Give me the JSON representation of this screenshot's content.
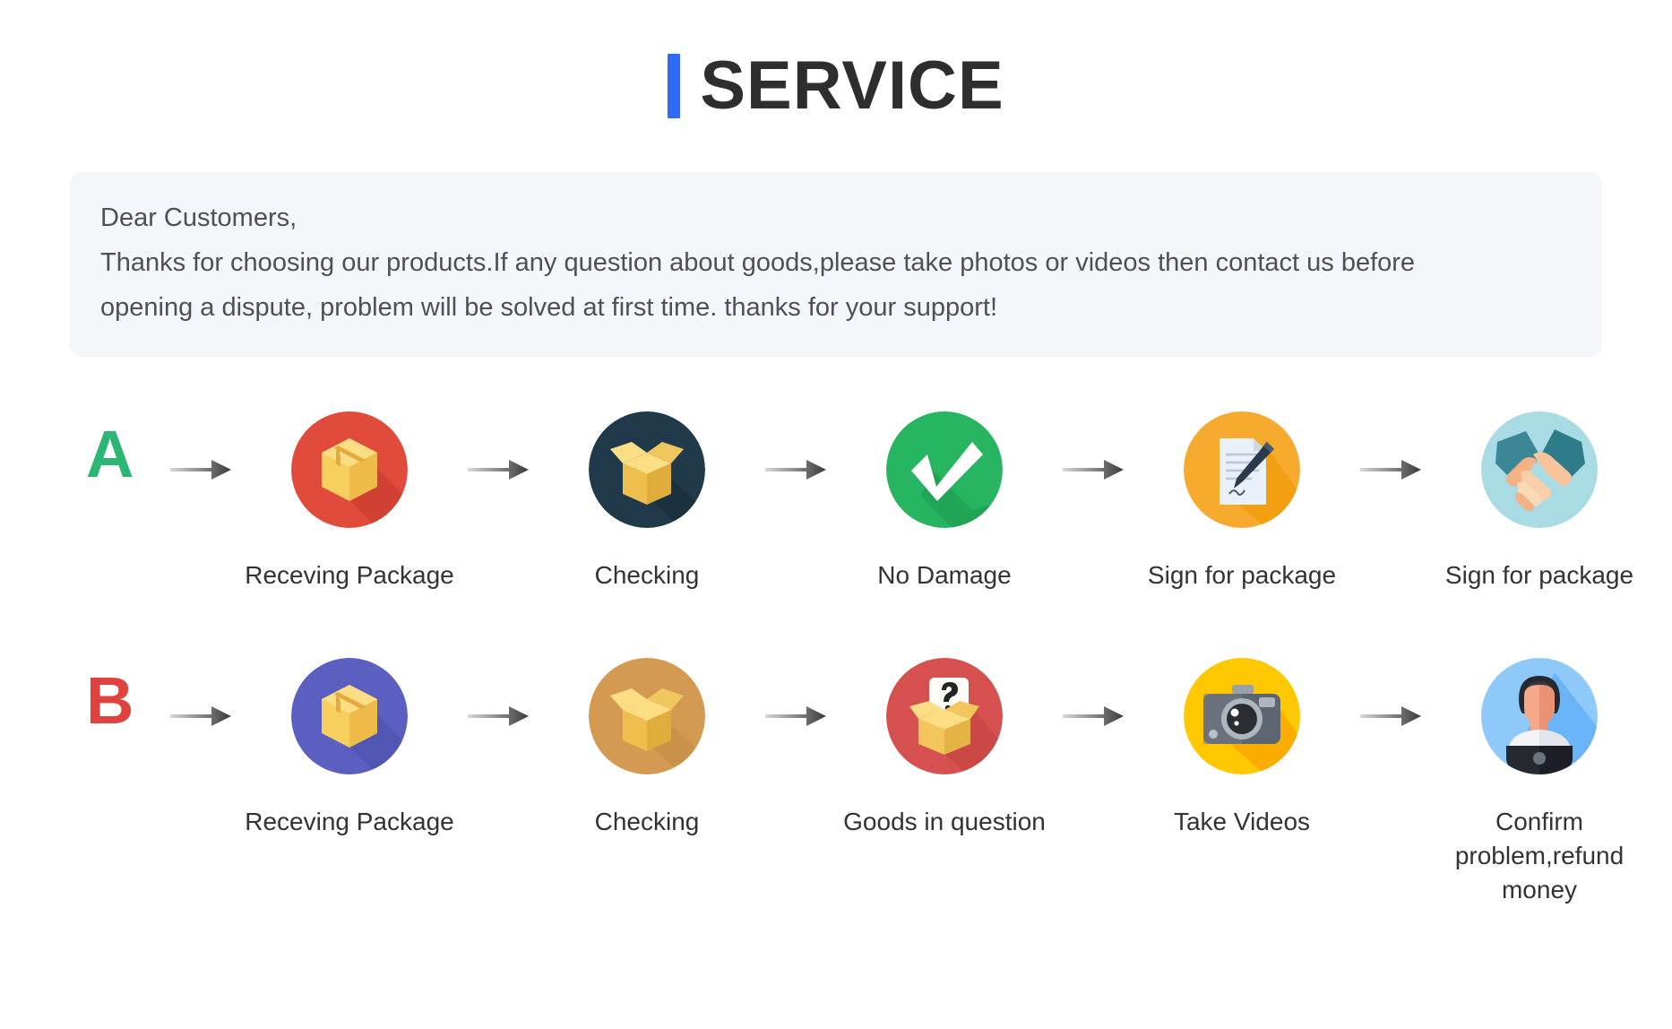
{
  "header": {
    "title": "SERVICE",
    "accent_color": "#2f6bf2",
    "title_color": "#2e2e2e"
  },
  "notice": {
    "background": "#f4f6fa",
    "text_color": "#4d5157",
    "lines": [
      "Dear Customers,",
      "Thanks for choosing our products.If any question about goods,please take photos or videos then contact us before",
      "opening a dispute, problem will be solved at first time. thanks for your support!"
    ]
  },
  "flows": [
    {
      "letter": "A",
      "letter_color": "#2bb673",
      "steps": [
        {
          "label": "Receving Package",
          "icon": "closed-box-icon",
          "circle_color": "#e04b3c",
          "shadow_color": "#c23b2e"
        },
        {
          "label": "Checking",
          "icon": "open-box-icon",
          "circle_color": "#20394b",
          "shadow_color": "#162936"
        },
        {
          "label": "No Damage",
          "icon": "check-mark-icon",
          "circle_color": "#27b562",
          "shadow_color": "#1d9d52"
        },
        {
          "label": "Sign for package",
          "icon": "sign-document-icon",
          "circle_color": "#f6ab2f",
          "shadow_color": "#f09700"
        },
        {
          "label": "Sign for package",
          "icon": "handshake-icon",
          "circle_color": "#a9dbe4",
          "shadow_color": "#3c8b99"
        }
      ]
    },
    {
      "letter": "B",
      "letter_color": "#e0423f",
      "steps": [
        {
          "label": "Receving Package",
          "icon": "closed-box-icon",
          "circle_color": "#5b5fc0",
          "shadow_color": "#4b4fa8"
        },
        {
          "label": "Checking",
          "icon": "open-box-icon",
          "circle_color": "#d59a52",
          "shadow_color": "#c08742"
        },
        {
          "label": "Goods in question",
          "icon": "question-box-icon",
          "circle_color": "#d6504f",
          "shadow_color": "#c2413f"
        },
        {
          "label": "Take Videos",
          "icon": "camera-icon",
          "circle_color": "#ffc800",
          "shadow_color": "#f9a800"
        },
        {
          "label": "Confirm problem,refund money",
          "icon": "support-person-icon",
          "circle_color": "#8fc9fa",
          "shadow_color": "#4aa3f5"
        }
      ]
    }
  ],
  "arrow": {
    "name": "right-arrow-icon",
    "color_start": "#d8d8d8",
    "color_end": "#3a3a3a"
  }
}
